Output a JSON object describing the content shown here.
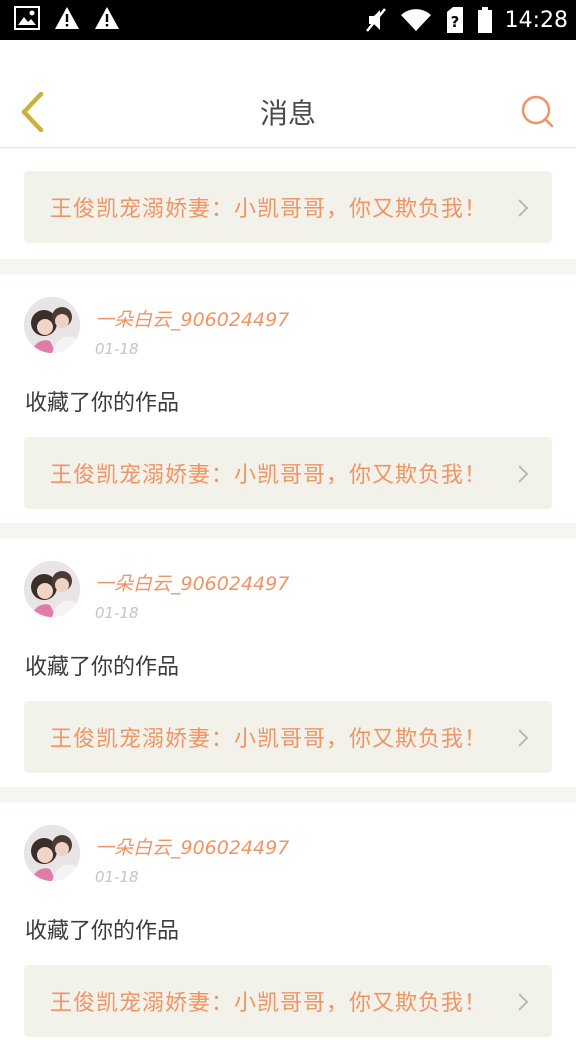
{
  "status_bar": {
    "time": "14:28",
    "icons": [
      "image-icon",
      "warning-icon",
      "warning-icon",
      "mute-icon",
      "wifi-icon",
      "sim-unknown-icon",
      "battery-icon"
    ]
  },
  "header": {
    "title": "消息",
    "back_icon": "chevron-left-icon",
    "search_icon": "search-icon"
  },
  "top_work": {
    "title": "王俊凯宠溺娇妻：小凯哥哥，你又欺负我！"
  },
  "messages": [
    {
      "user": "一朵白云_906024497",
      "date": "01-18",
      "text": "收藏了你的作品",
      "work_title": "王俊凯宠溺娇妻：小凯哥哥，你又欺负我！"
    },
    {
      "user": "一朵白云_906024497",
      "date": "01-18",
      "text": "收藏了你的作品",
      "work_title": "王俊凯宠溺娇妻：小凯哥哥，你又欺负我！"
    },
    {
      "user": "一朵白云_906024497",
      "date": "01-18",
      "text": "收藏了你的作品",
      "work_title": "王俊凯宠溺娇妻：小凯哥哥，你又欺负我！"
    }
  ],
  "colors": {
    "accent": "#ef9464",
    "card_bg": "#f3f2ea",
    "back_icon": "#c9b13a"
  }
}
